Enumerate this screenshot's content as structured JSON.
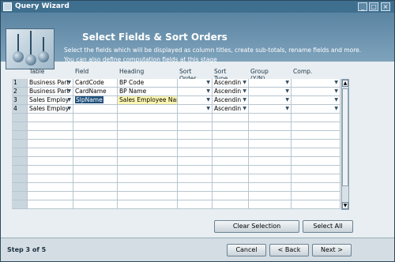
{
  "window": {
    "title": "Query Wizard",
    "controls": [
      "_",
      "□",
      "×"
    ]
  },
  "banner": {
    "title": "Select Fields & Sort Orders",
    "description_line1": "Select the fields which will be displayed as column titles, create sub-totals, rename fields and more.",
    "description_line2": "You can also define computation fields at this stage"
  },
  "grid": {
    "headers": [
      "",
      "Table",
      "Field",
      "Heading",
      "Sort Order",
      "Sort Type",
      "Group (Y/N)",
      "Comp."
    ],
    "rows": [
      {
        "num": "1",
        "table": "Business Part",
        "field": "CardCode",
        "heading": "BP Code",
        "sort_order": "",
        "sort_type": "Ascendin",
        "group": "",
        "comp": ""
      },
      {
        "num": "2",
        "table": "Business Part",
        "field": "CardName",
        "heading": "BP Name",
        "sort_order": "",
        "sort_type": "Ascendin",
        "group": "",
        "comp": ""
      },
      {
        "num": "3",
        "table": "Sales Employ",
        "field": "SlpName",
        "heading": "Sales Employee Nam",
        "sort_order": "",
        "sort_type": "Ascendin",
        "group": "",
        "comp": ""
      },
      {
        "num": "4",
        "table": "Sales Employ",
        "field": "",
        "heading": "",
        "sort_order": "",
        "sort_type": "Ascendin",
        "group": "",
        "comp": ""
      }
    ],
    "empty_rows": 11
  },
  "buttons": {
    "clear_selection": "Clear Selection",
    "select_all": "Select All",
    "cancel": "Cancel",
    "back": "< Back",
    "next": "Next >"
  },
  "footer": {
    "step": "Step 3 of 5"
  },
  "colors": {
    "titlebar": "#3f6f8f",
    "banner": "#5a84a2",
    "body": "#e8eef1",
    "selected": "#1e4f7a"
  }
}
